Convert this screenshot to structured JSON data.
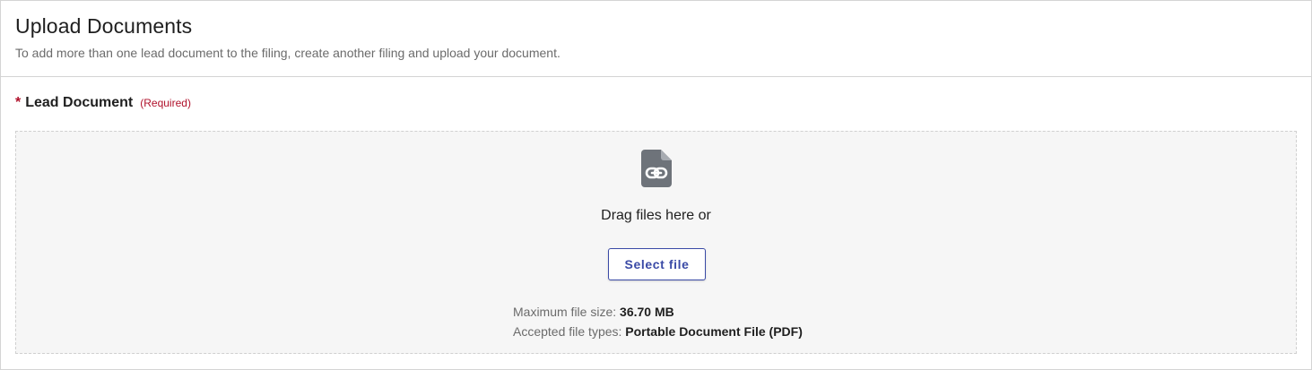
{
  "header": {
    "title": "Upload Documents",
    "subtitle": "To add more than one lead document to the filing, create another filing and upload your document."
  },
  "lead_document": {
    "required_star": "*",
    "label": "Lead Document",
    "required_note": "(Required)",
    "dropzone": {
      "icon": "document-link-icon",
      "drag_text": "Drag files here or",
      "select_button_label": "Select file",
      "max_size_label": "Maximum file size:",
      "max_size_value": "36.70 MB",
      "accepted_types_label": "Accepted file types:",
      "accepted_types_value": "Portable Document File (PDF)"
    }
  },
  "colors": {
    "required_red": "#b0112b",
    "button_blue": "#3a4aa6",
    "icon_gray": "#6e737a",
    "dropzone_bg": "#f6f6f6"
  }
}
